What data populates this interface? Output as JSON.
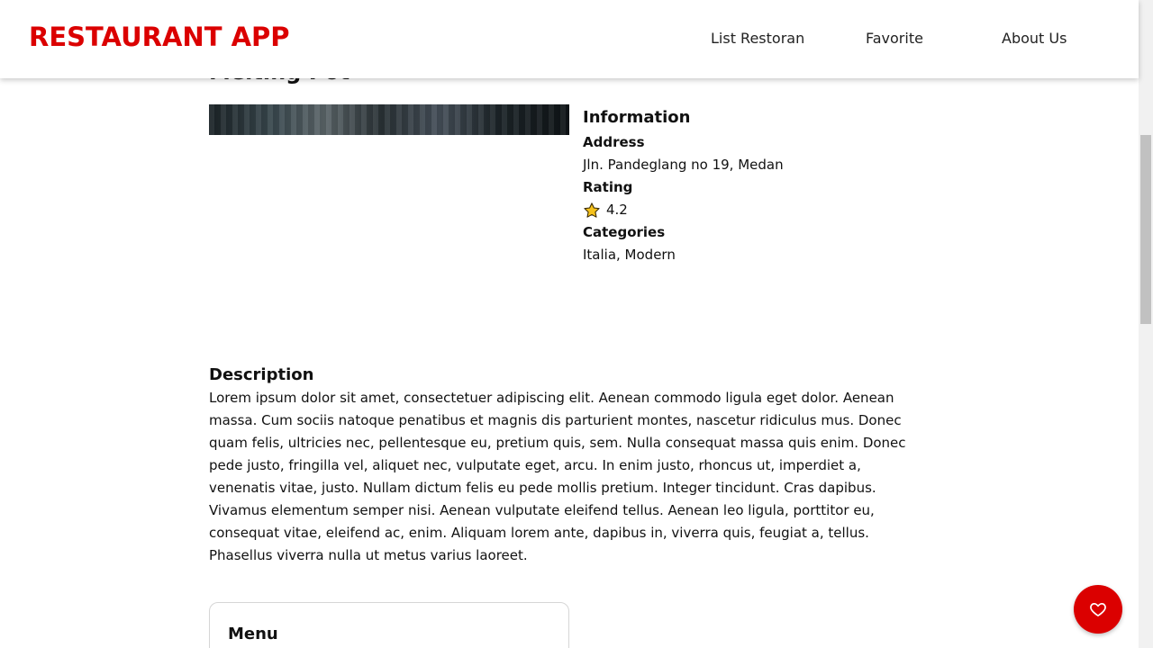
{
  "app": {
    "brand": "RESTAURANT APP",
    "brand_color": "#db0000"
  },
  "nav": {
    "items": [
      {
        "label": "List Restoran"
      },
      {
        "label": "Favorite"
      },
      {
        "label": "About Us"
      }
    ]
  },
  "restaurant": {
    "name": "Melting Pot",
    "information": {
      "title": "Information",
      "address_label": "Address",
      "address": "Jln. Pandeglang no 19, Medan",
      "rating_label": "Rating",
      "rating": "4.2",
      "categories_label": "Categories",
      "categories": "Italia, Modern"
    },
    "description": {
      "title": "Description",
      "text": "Lorem ipsum dolor sit amet, consectetuer adipiscing elit. Aenean commodo ligula eget dolor. Aenean massa. Cum sociis natoque penatibus et magnis dis parturient montes, nascetur ridiculus mus. Donec quam felis, ultricies nec, pellentesque eu, pretium quis, sem. Nulla consequat massa quis enim. Donec pede justo, fringilla vel, aliquet nec, vulputate eget, arcu. In enim justo, rhoncus ut, imperdiet a, venenatis vitae, justo. Nullam dictum felis eu pede mollis pretium. Integer tincidunt. Cras dapibus. Vivamus elementum semper nisi. Aenean vulputate eleifend tellus. Aenean leo ligula, porttitor eu, consequat vitae, eleifend ac, enim. Aliquam lorem ante, dapibus in, viverra quis, feugiat a, tellus. Phasellus viverra nulla ut metus varius laoreet."
    },
    "menu": {
      "title": "Menu"
    }
  },
  "icons": {
    "rating": "star-icon",
    "favorite": "heart-icon"
  },
  "colors": {
    "accent": "#db0000",
    "star_fill": "#f6c21c"
  }
}
